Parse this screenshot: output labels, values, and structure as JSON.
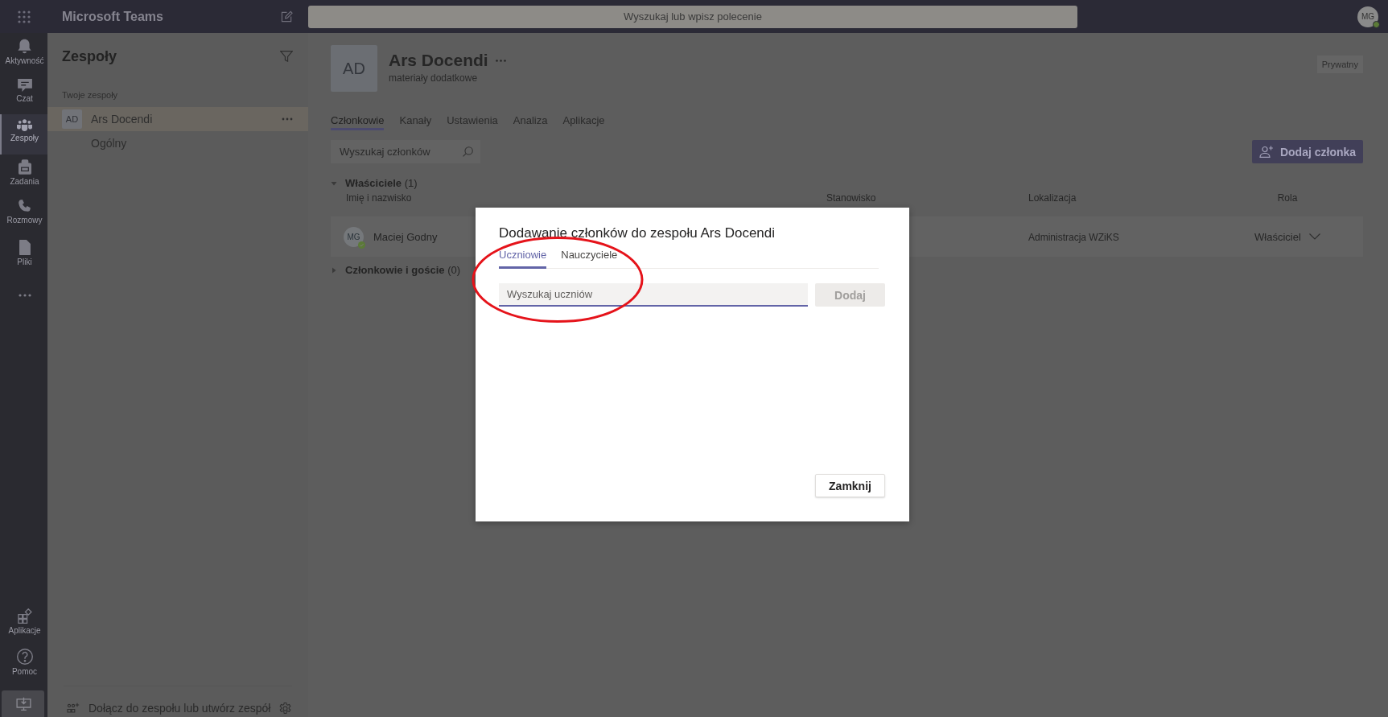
{
  "top_bar": {
    "app_title": "Microsoft Teams",
    "search": {
      "placeholder": "Wyszukaj lub wpisz polecenie"
    },
    "avatar": "MG"
  },
  "rail": {
    "items": [
      {
        "kind": "activity",
        "label": "Aktywność",
        "selected": false
      },
      {
        "kind": "chat",
        "label": "Czat",
        "selected": false
      },
      {
        "kind": "teams",
        "label": "Zespoły",
        "selected": true
      },
      {
        "kind": "assignments",
        "label": "Zadania",
        "selected": false
      },
      {
        "kind": "calls",
        "label": "Rozmowy",
        "selected": false
      },
      {
        "kind": "files",
        "label": "Pliki",
        "selected": false
      },
      {
        "kind": "more",
        "selected": false
      }
    ],
    "bottom_items": [
      {
        "kind": "apps",
        "label": "Aplikacje",
        "selected": false
      },
      {
        "kind": "help",
        "label": "Pomoc",
        "selected": false
      },
      {
        "kind": "download",
        "selected": false
      }
    ]
  },
  "sidebar": {
    "title": "Zespoły",
    "section_label": "Twoje zespoły",
    "teams": [
      {
        "initials": "AD",
        "name": "Ars Docendi",
        "selected": true,
        "children": [
          {
            "name": "Ogólny",
            "selected": false
          }
        ]
      }
    ],
    "footer_link": "Dołącz do zespołu lub utwórz zespół"
  },
  "team_header": {
    "initials": "AD",
    "name": "Ars Docendi",
    "description": "materiały dodatkowe",
    "privacy": "Prywatny"
  },
  "tabs": [
    {
      "label": "Członkowie",
      "selected": true
    },
    {
      "label": "Kanały",
      "selected": false
    },
    {
      "label": "Ustawienia",
      "selected": false
    },
    {
      "label": "Analiza",
      "selected": false
    },
    {
      "label": "Aplikacje",
      "selected": false
    }
  ],
  "member_search": {
    "placeholder": "Wyszukaj członków"
  },
  "add_member_button": "Dodaj członka",
  "sections": [
    {
      "title": "**Właściciele** (1)",
      "expanded": true,
      "columns": [
        "Imię i nazwisko",
        "Stanowisko",
        "Lokalizacja",
        "Rola"
      ],
      "rows": [
        {
          "initials": "MG",
          "name": "Maciej Godny",
          "location": "Administracja WZiKS",
          "role": "Właściciel"
        }
      ]
    },
    {
      "title": "**Członkowie i goście** (0)",
      "expanded": false
    }
  ],
  "dialog": {
    "title": "Dodawanie członków do zespołu Ars Docendi",
    "tabs": [
      {
        "label": "Uczniowie",
        "selected": true
      },
      {
        "label": "Nauczyciele",
        "selected": false
      }
    ],
    "search": {
      "placeholder": "Wyszukaj uczniów"
    },
    "add_button": {
      "label": "Dodaj",
      "disabled": true
    },
    "close_button": "Zamknij"
  }
}
